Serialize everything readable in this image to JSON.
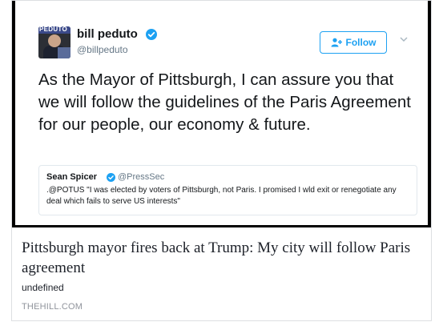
{
  "tweet": {
    "avatar_text": "PEDUTO",
    "author_name": "bill peduto",
    "author_handle": "@billpeduto",
    "follow_label": "Follow",
    "text": "As the Mayor of Pittsburgh, I can assure you that we will follow the guidelines of the Paris Agreement for our people, our economy & future.",
    "quote": {
      "author_name": "Sean Spicer",
      "author_handle": "@PressSec",
      "text": ".@POTUS \"I was elected by voters of Pittsburgh, not Paris. I promised I wld exit or renegotiate any deal which fails to serve US interests\""
    }
  },
  "link": {
    "headline": "Pittsburgh mayor fires back at Trump: My city will follow Paris agreement",
    "description": "undefined",
    "domain": "THEHILL.COM"
  },
  "colors": {
    "twitter_blue": "#1da1f2",
    "text_dark": "#14171a",
    "text_muted": "#657786",
    "domain_gray": "#90949c"
  },
  "icons": [
    "verified-badge-icon",
    "add-user-icon",
    "chevron-down-icon"
  ]
}
